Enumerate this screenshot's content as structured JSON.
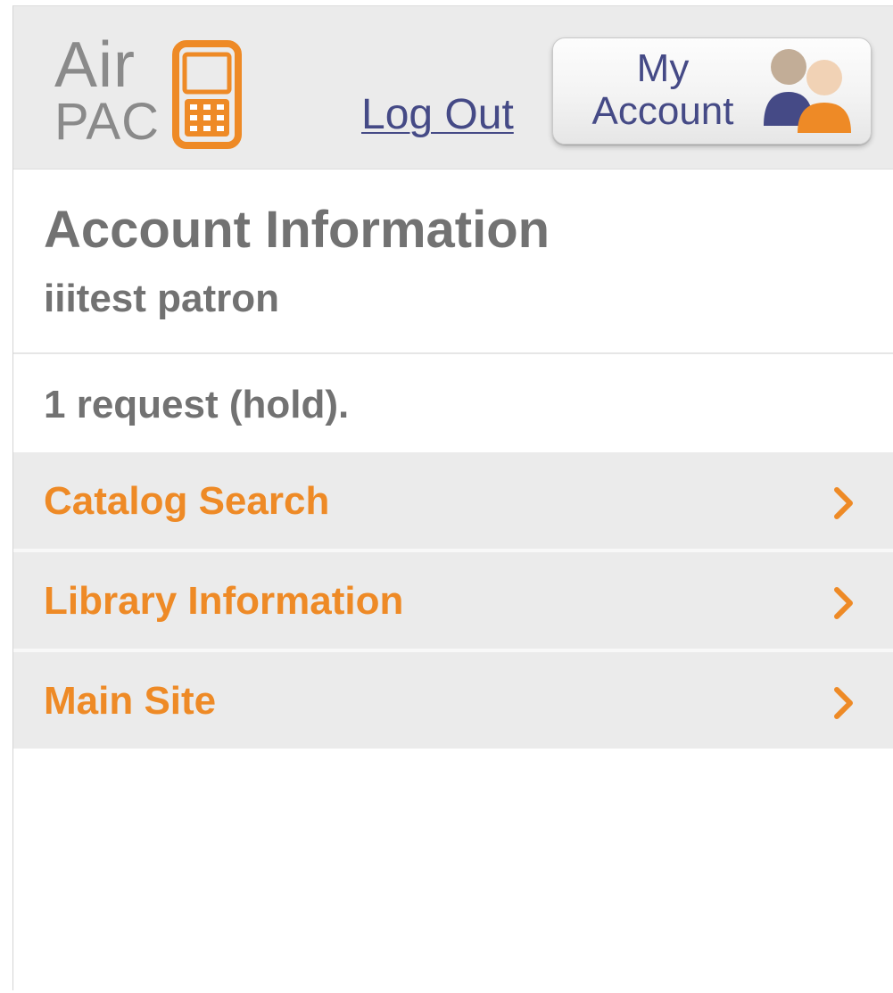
{
  "header": {
    "logo": {
      "line1": "Air",
      "line2": "PAC"
    },
    "logout_label": "Log Out",
    "account_button": {
      "line1": "My",
      "line2": "Account"
    }
  },
  "account": {
    "title": "Account Information",
    "patron_name": "iiitest patron",
    "holds_summary": "1 request (hold)."
  },
  "nav": {
    "items": [
      {
        "label": "Catalog Search"
      },
      {
        "label": "Library Information"
      },
      {
        "label": "Main Site"
      }
    ]
  },
  "icons": {
    "logo_phone": "phone-icon",
    "account_people": "people-icon",
    "chevron": "chevron-right-icon"
  },
  "colors": {
    "accent_orange": "#ee8a26",
    "link_navy": "#454a86",
    "text_gray": "#727272",
    "header_bg": "#ebebeb"
  }
}
